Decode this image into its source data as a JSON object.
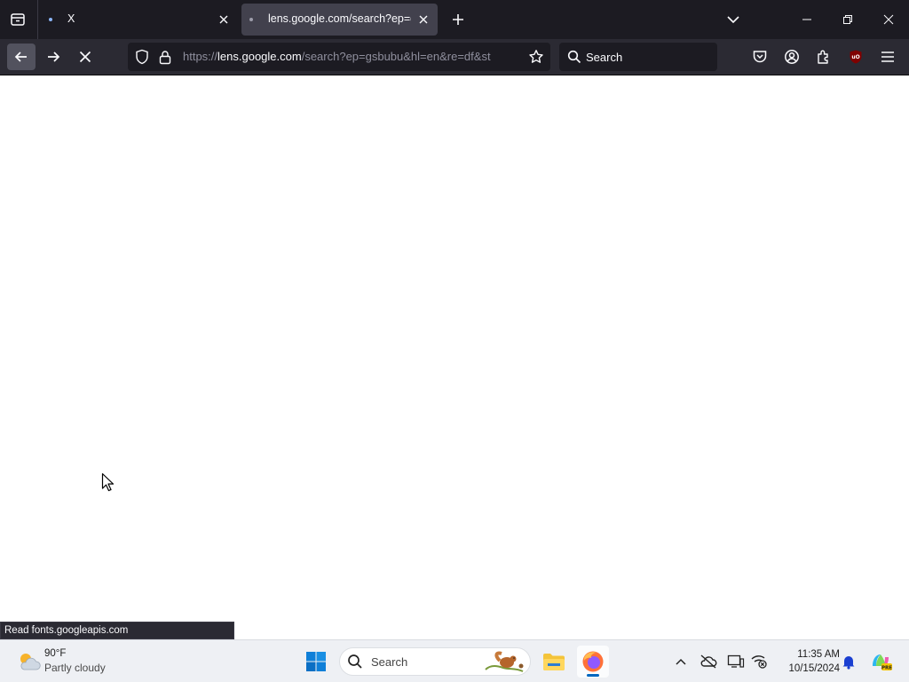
{
  "tabs": [
    {
      "title": "X",
      "active": false
    },
    {
      "title": "lens.google.com/search?ep=gsbubu&hl=en&re=df&st",
      "active": true
    }
  ],
  "navbar": {
    "url_prefix": "https://",
    "url_host": "lens.google.com",
    "url_path": "/search?ep=gsbubu&hl=en&re=df&st",
    "search_placeholder": "Search"
  },
  "status_text": "Read fonts.googleapis.com",
  "taskbar": {
    "weather_temp": "90°F",
    "weather_condition": "Partly cloudy",
    "search_placeholder": "Search",
    "time": "11:35 AM",
    "date": "10/15/2024"
  },
  "colors": {
    "tab_strip_bg": "#1c1b22",
    "toolbar_bg": "#2b2a33",
    "taskbar_bg": "#eef0f4",
    "accent": "#0067c0"
  }
}
